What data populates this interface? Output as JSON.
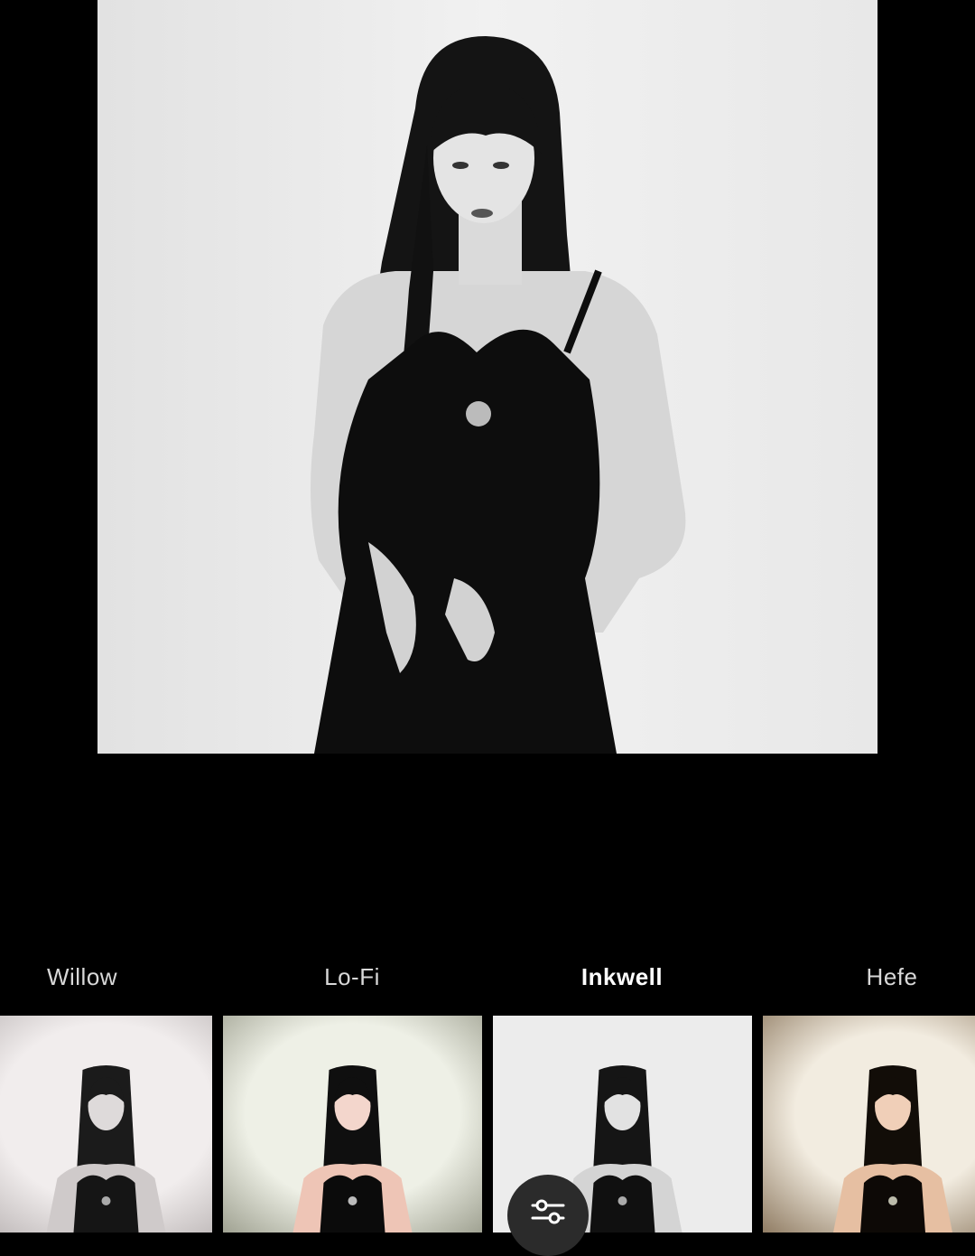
{
  "filters": {
    "items": [
      {
        "label": "Willow",
        "active": false
      },
      {
        "label": "Lo-Fi",
        "active": false
      },
      {
        "label": "Inkwell",
        "active": true
      },
      {
        "label": "Hefe",
        "active": false
      }
    ],
    "selected": "Inkwell"
  },
  "icons": {
    "adjust": "sliders-icon"
  },
  "colors": {
    "background": "#000000",
    "label_inactive": "#d8d8d8",
    "label_active": "#ffffff",
    "adjust_button_bg": "#2b2b2b"
  }
}
